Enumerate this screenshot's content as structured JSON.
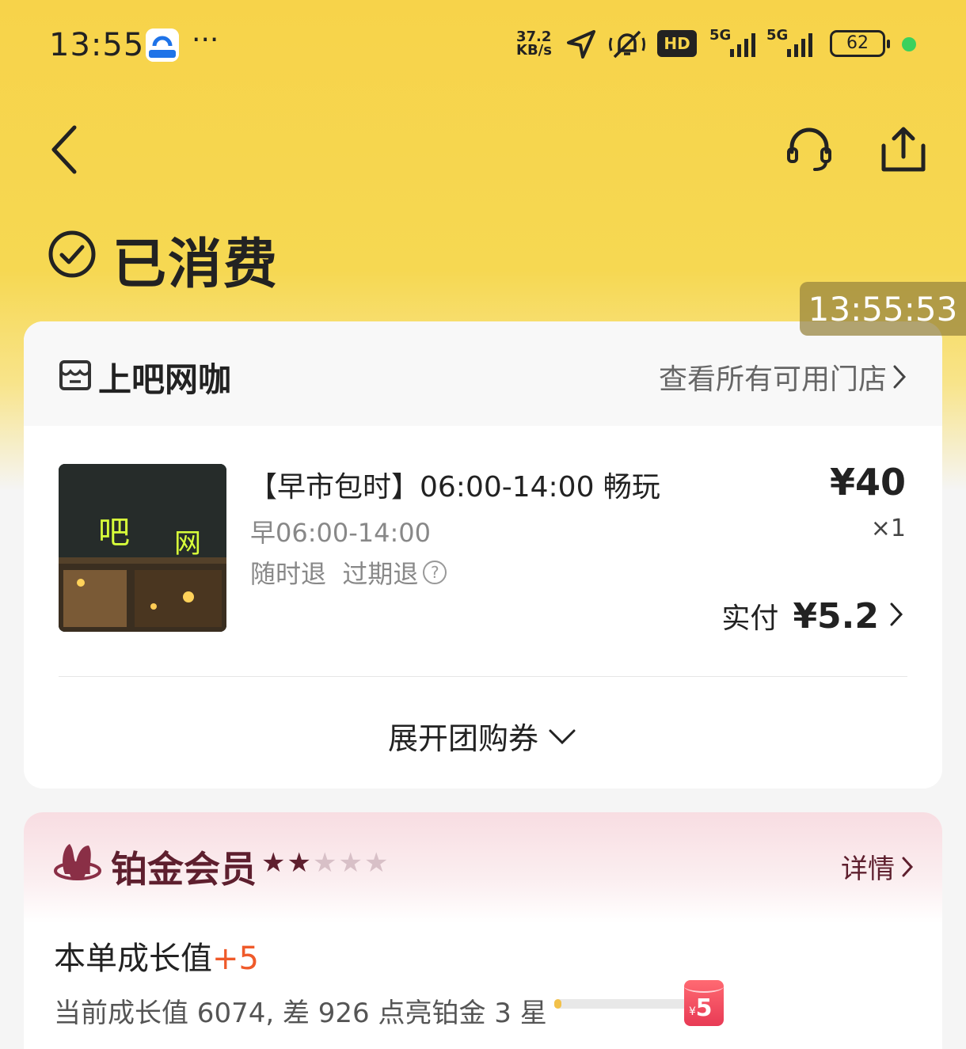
{
  "status_bar": {
    "time": "13:55",
    "more": "···",
    "speed_value": "37.2",
    "speed_unit": "KB/s",
    "hd_label": "HD",
    "net1": "5G",
    "net2": "5G",
    "battery": "62"
  },
  "nav": {
    "back_icon": "chevron-left-icon",
    "support_icon": "headset-icon",
    "share_icon": "share-icon"
  },
  "order_status": {
    "title": "已消费",
    "timestamp": "13:55:53"
  },
  "shop": {
    "name": "上吧网咖",
    "view_all": "查看所有可用门店"
  },
  "item": {
    "thumb_text_1": "吧",
    "thumb_text_2": "网",
    "title": "【早市包时】06:00-14:00 畅玩",
    "subtitle": "早06:00-14:00",
    "refund": "随时退  过期退",
    "help": "?",
    "price": "¥40",
    "qty": "×1",
    "paid_label": "实付",
    "paid_amount": "¥5.2"
  },
  "expand": {
    "label": "展开团购券"
  },
  "member": {
    "title": "铂金会员",
    "stars_filled": 2,
    "stars_total": 5,
    "details": "详情",
    "growth_label": "本单成长值",
    "growth_plus": "+5",
    "progress_text": "当前成长值 6074, 差 926 点亮铂金 3 星",
    "progress_ratio": 0.05,
    "reward": "5",
    "reward_currency": "¥"
  },
  "colors": {
    "hero_yellow": "#f7d34a",
    "member_maroon": "#5e1f2e",
    "growth_orange": "#ef5a2a"
  }
}
